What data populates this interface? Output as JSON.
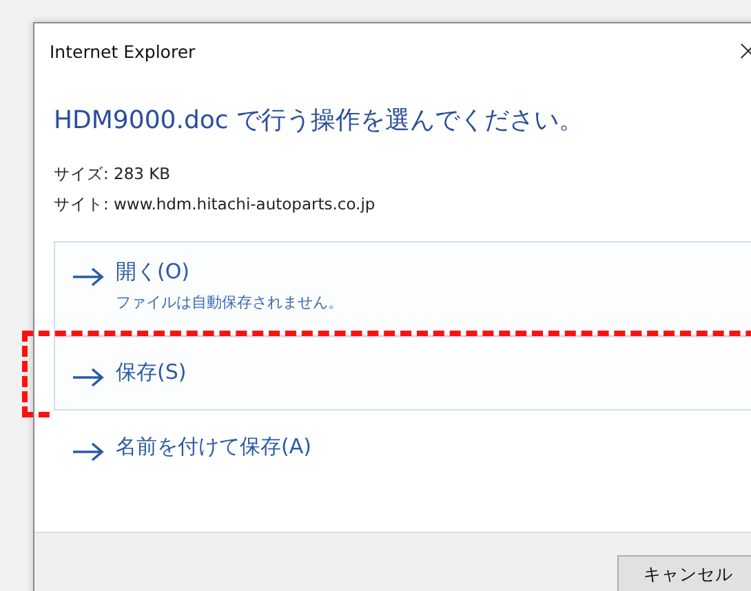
{
  "window": {
    "title": "Internet Explorer"
  },
  "heading": "HDM9000.doc で行う操作を選んでください。",
  "info": [
    "サイズ: 283 KB",
    "サイト: www.hdm.hitachi-autoparts.co.jp"
  ],
  "options": [
    {
      "label": "開く(O)",
      "note": "ファイルは自動保存されません。",
      "bordered": true,
      "highlighted": false
    },
    {
      "label": "保存(S)",
      "bordered": true,
      "highlighted": true
    },
    {
      "label": "名前を付けて保存(A)",
      "bordered": false,
      "highlighted": false
    }
  ],
  "buttons": [
    "キャンセル"
  ]
}
